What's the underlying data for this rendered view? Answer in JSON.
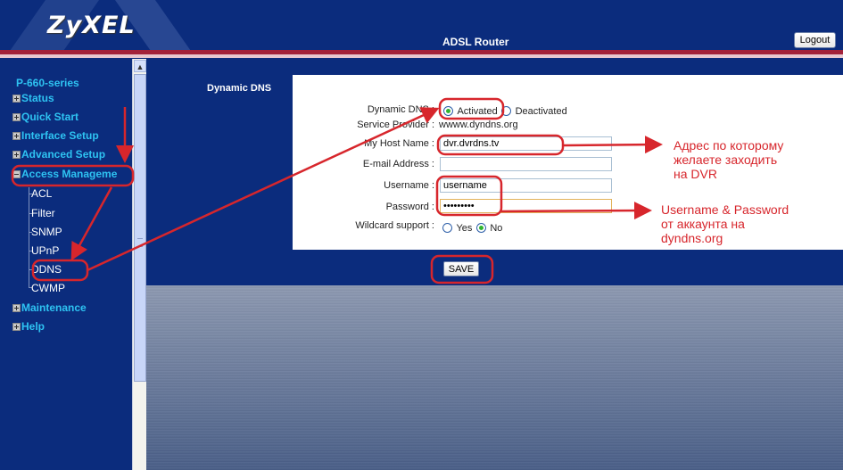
{
  "header": {
    "logo": "ZyXEL",
    "title": "ADSL Router",
    "logout_label": "Logout"
  },
  "sidebar": {
    "root": "P-660-series",
    "items": [
      {
        "label": "Status",
        "expanded": false
      },
      {
        "label": "Quick Start",
        "expanded": false
      },
      {
        "label": "Interface Setup",
        "expanded": false
      },
      {
        "label": "Advanced Setup",
        "expanded": false
      },
      {
        "label": "Access Manageme",
        "expanded": true
      },
      {
        "label": "Maintenance",
        "expanded": false
      },
      {
        "label": "Help",
        "expanded": false
      }
    ],
    "access_subitems": [
      "ACL",
      "Filter",
      "SNMP",
      "UPnP",
      "DDNS",
      "CWMP"
    ]
  },
  "main": {
    "section_label": "Dynamic DNS",
    "form": {
      "dynamic_dns_label": "Dynamic DNS :",
      "activated_label": "Activated",
      "deactivated_label": "Deactivated",
      "dynamic_dns_value": "Activated",
      "service_provider_label": "Service Provider :",
      "service_provider_value": "wwww.dyndns.org",
      "host_name_label": "My Host Name :",
      "host_name_value": "dvr.dvrdns.tv",
      "email_label": "E-mail Address :",
      "email_value": "",
      "username_label": "Username :",
      "username_value": "username",
      "password_label": "Password :",
      "password_value": "•••••••••",
      "wildcard_label": "Wildcard support :",
      "wildcard_yes": "Yes",
      "wildcard_no": "No",
      "wildcard_value": "No"
    },
    "save_label": "SAVE"
  },
  "annotations": {
    "host_note": [
      "Адрес по которому",
      "желаете заходить",
      "на DVR"
    ],
    "credentials_note": [
      "Username & Password",
      "от аккаунта на",
      "dyndns.org"
    ],
    "color": "#d7262c"
  }
}
